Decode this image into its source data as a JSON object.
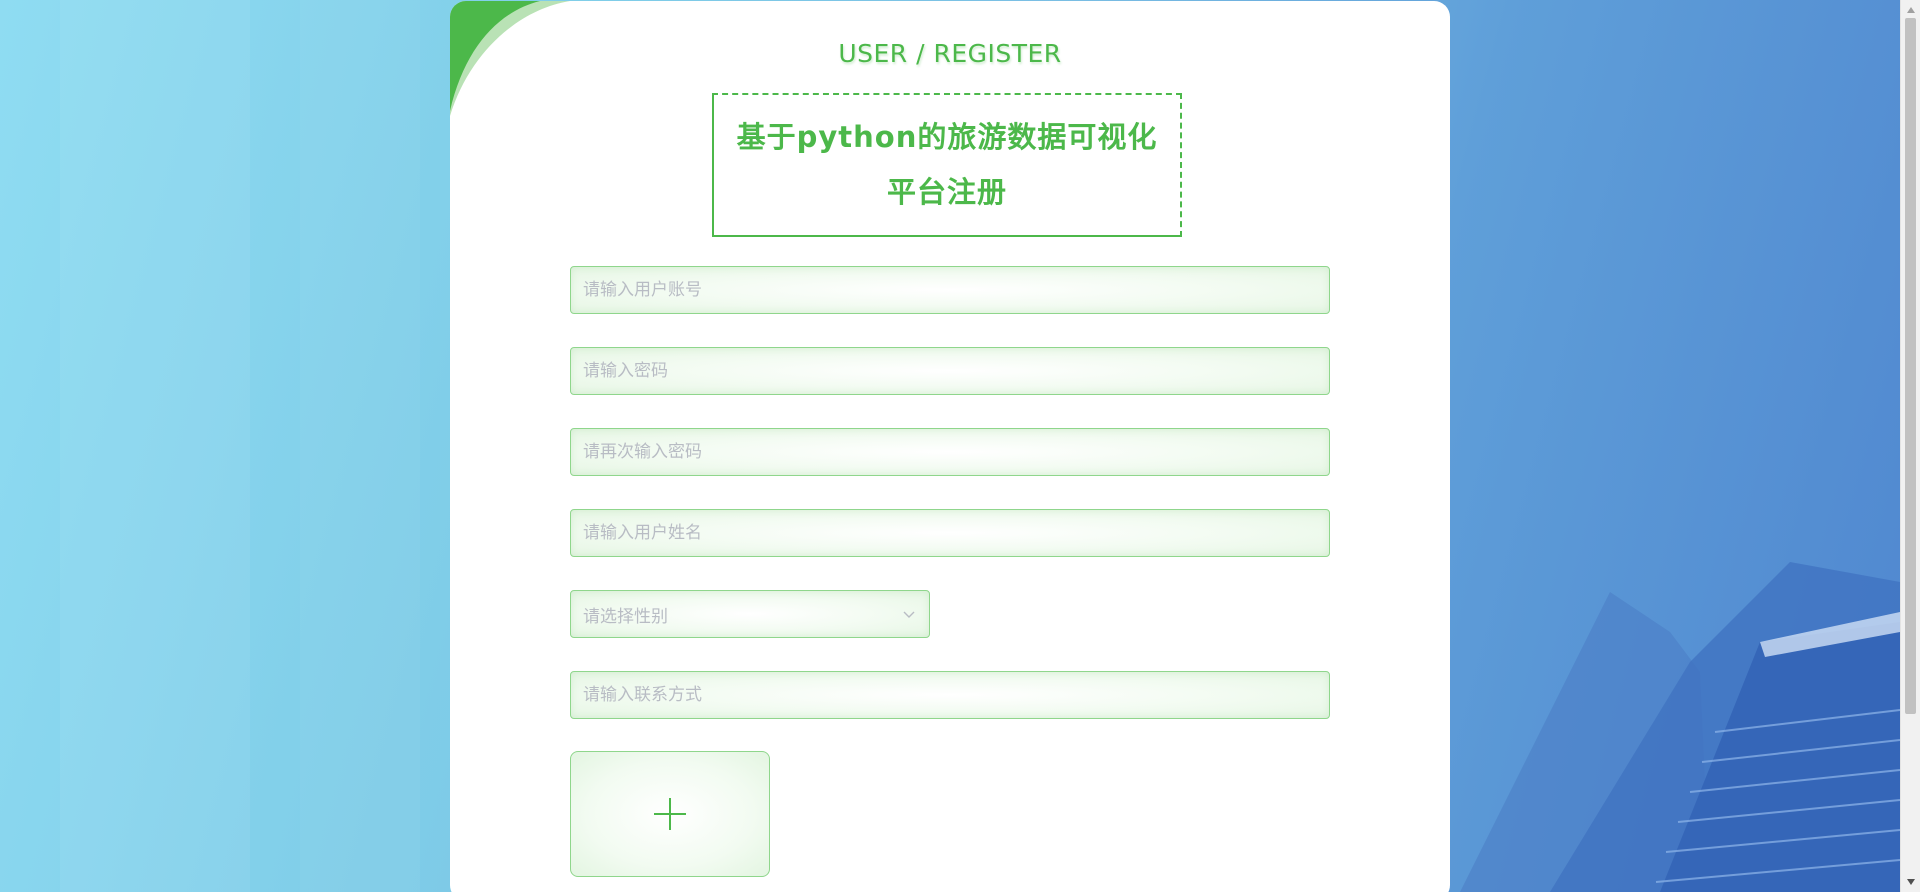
{
  "page": {
    "subtitle": "USER / REGISTER",
    "title_line1": "基于python的旅游数据可视化",
    "title_line2": "平台注册"
  },
  "form": {
    "account": {
      "placeholder": "请输入用户账号",
      "value": ""
    },
    "password": {
      "placeholder": "请输入密码",
      "value": ""
    },
    "password_confirm": {
      "placeholder": "请再次输入密码",
      "value": ""
    },
    "username": {
      "placeholder": "请输入用户姓名",
      "value": ""
    },
    "gender": {
      "placeholder": "请选择性别",
      "value": ""
    },
    "contact": {
      "placeholder": "请输入联系方式",
      "value": ""
    },
    "avatar_upload": {
      "icon": "plus-icon"
    }
  },
  "colors": {
    "accent": "#4cb84a",
    "field_border": "#8fd68c",
    "placeholder": "#b8bcc4"
  }
}
